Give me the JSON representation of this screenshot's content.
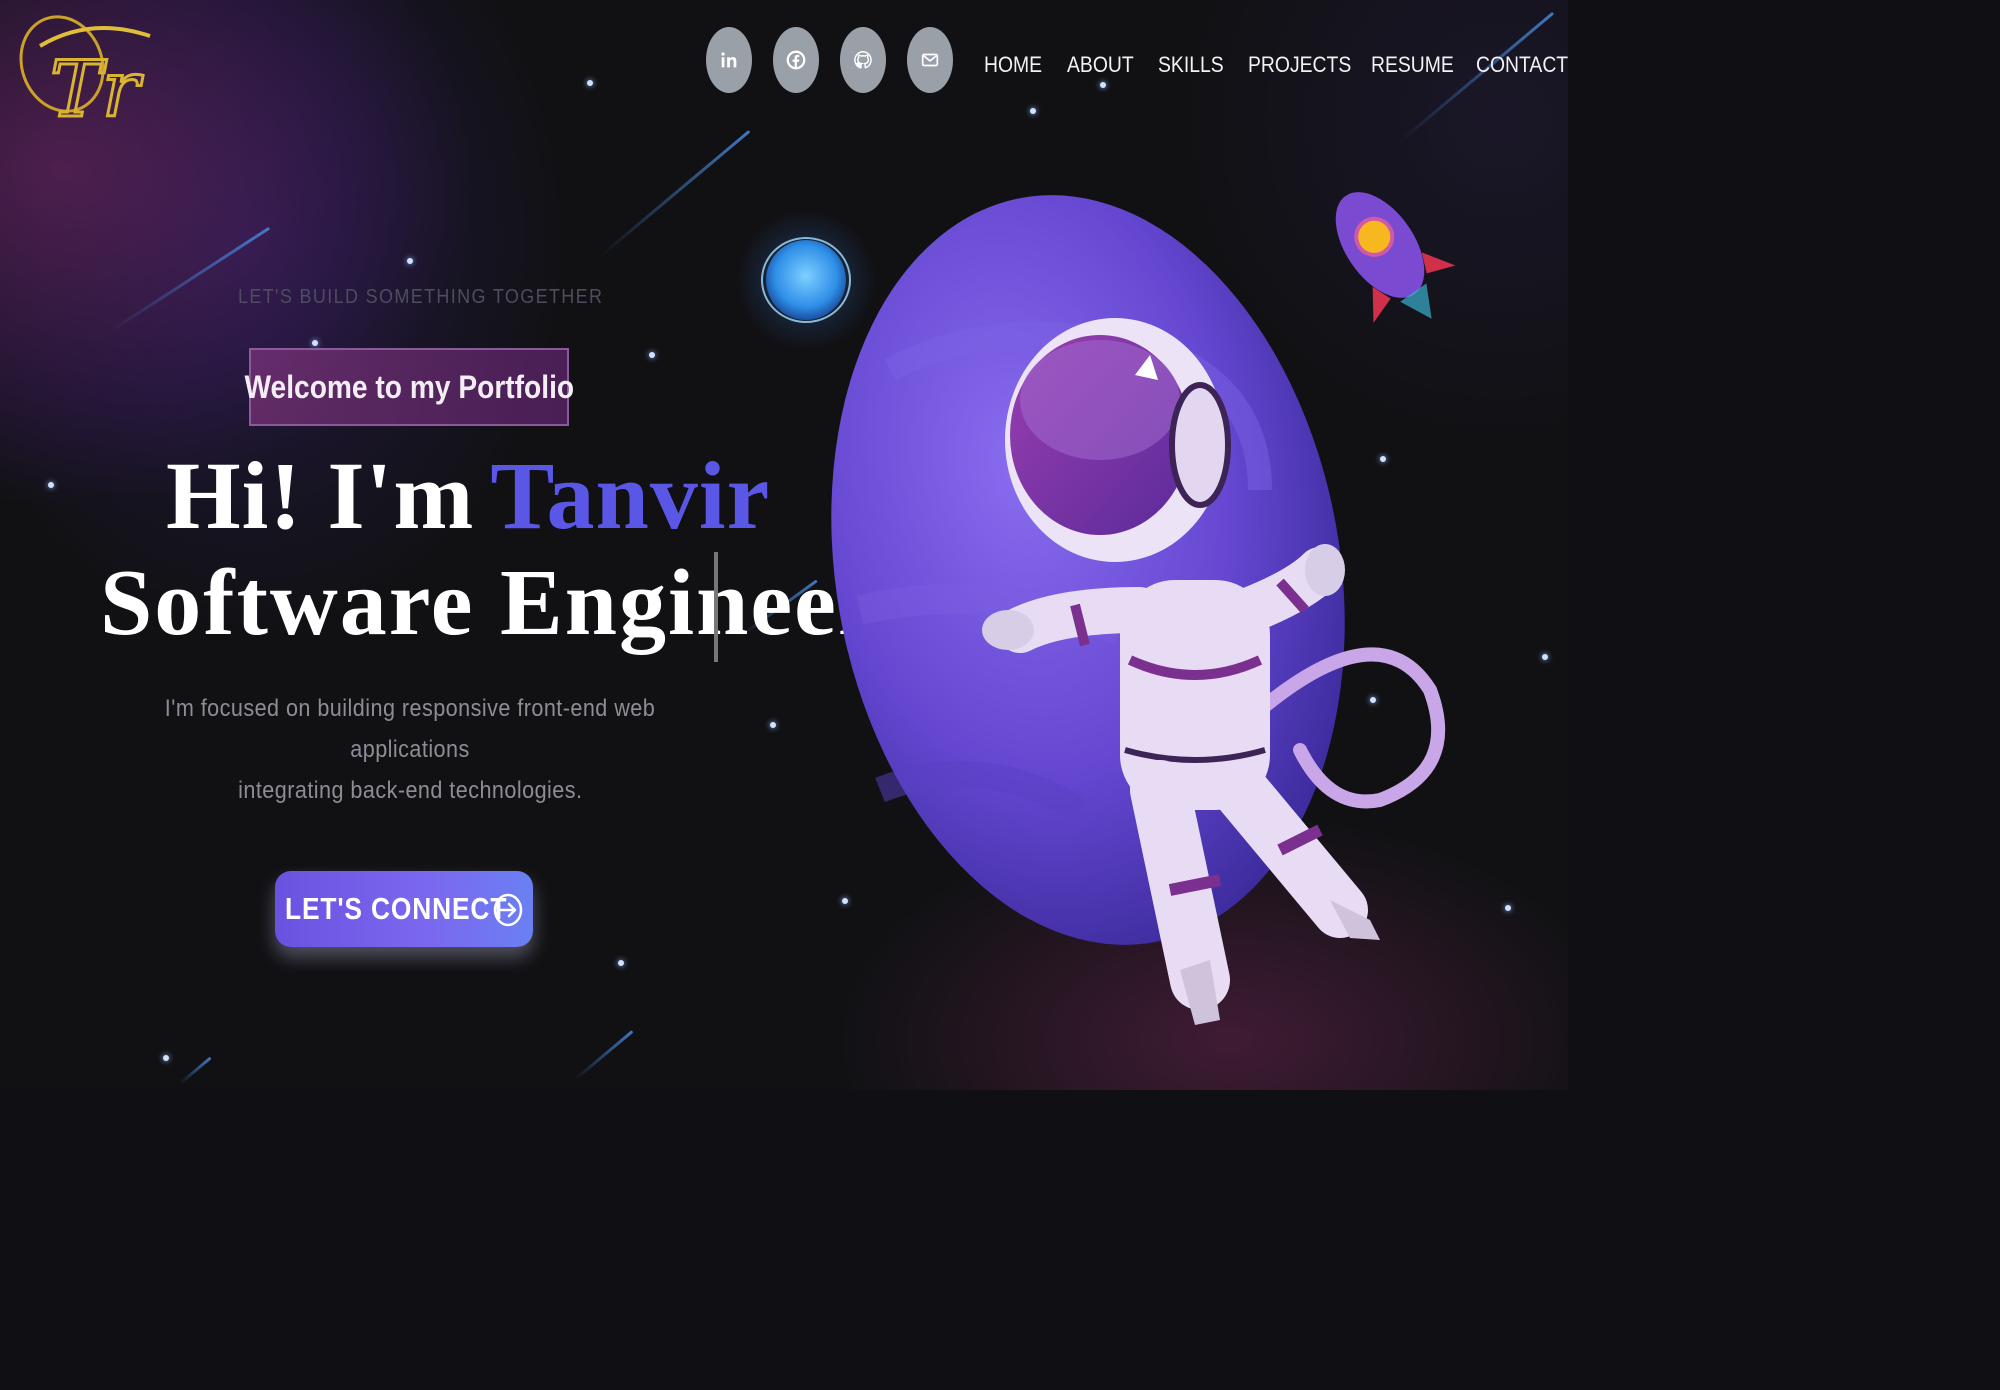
{
  "brand": {
    "logo_text": "Tr"
  },
  "social": [
    {
      "name": "linkedin",
      "icon": "linkedin-icon",
      "glyph": "in"
    },
    {
      "name": "facebook",
      "icon": "facebook-icon"
    },
    {
      "name": "github",
      "icon": "github-icon"
    },
    {
      "name": "email",
      "icon": "mail-icon"
    }
  ],
  "nav": {
    "home": "HOME",
    "about": "ABOUT",
    "skills": "SKILLS",
    "projects": "PROJECTS",
    "resume": "RESUME",
    "contact": "CONTACT"
  },
  "hero": {
    "tagline": "LET'S BUILD SOMETHING TOGETHER",
    "welcome": "Welcome to my Portfolio",
    "greeting": "Hi! I'm",
    "name": "Tanvir",
    "role": "Software Engineer",
    "desc_line1": "I'm focused on building responsive front-end web applications",
    "desc_line2": "integrating back-end technologies.",
    "cta": "LET'S CONNECT"
  },
  "colors": {
    "accent": "#5b57e6",
    "logo_gold": "#d8b430",
    "cta_start": "#6a52e0",
    "cta_end": "#6a80f2",
    "planet": "#6a4bd6"
  }
}
